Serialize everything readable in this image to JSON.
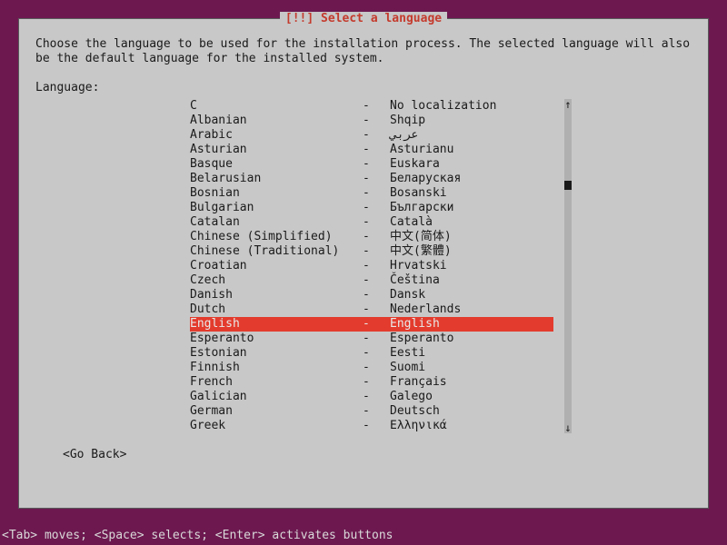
{
  "dialog": {
    "title": "[!!] Select a language",
    "instruction": "Choose the language to be used for the installation process. The selected language will also be the default language for the installed system.",
    "label": "Language:",
    "go_back": "<Go Back>"
  },
  "selected_index": 15,
  "languages": [
    {
      "name": "C",
      "native": "No localization"
    },
    {
      "name": "Albanian",
      "native": "Shqip"
    },
    {
      "name": "Arabic",
      "native": "عربي"
    },
    {
      "name": "Asturian",
      "native": "Asturianu"
    },
    {
      "name": "Basque",
      "native": "Euskara"
    },
    {
      "name": "Belarusian",
      "native": "Беларуская"
    },
    {
      "name": "Bosnian",
      "native": "Bosanski"
    },
    {
      "name": "Bulgarian",
      "native": "Български"
    },
    {
      "name": "Catalan",
      "native": "Català"
    },
    {
      "name": "Chinese (Simplified)",
      "native": "中文(简体)"
    },
    {
      "name": "Chinese (Traditional)",
      "native": "中文(繁體)"
    },
    {
      "name": "Croatian",
      "native": "Hrvatski"
    },
    {
      "name": "Czech",
      "native": "Čeština"
    },
    {
      "name": "Danish",
      "native": "Dansk"
    },
    {
      "name": "Dutch",
      "native": "Nederlands"
    },
    {
      "name": "English",
      "native": "English"
    },
    {
      "name": "Esperanto",
      "native": "Esperanto"
    },
    {
      "name": "Estonian",
      "native": "Eesti"
    },
    {
      "name": "Finnish",
      "native": "Suomi"
    },
    {
      "name": "French",
      "native": "Français"
    },
    {
      "name": "Galician",
      "native": "Galego"
    },
    {
      "name": "German",
      "native": "Deutsch"
    },
    {
      "name": "Greek",
      "native": "Ελληνικά"
    }
  ],
  "separator": "-",
  "footer": "<Tab> moves; <Space> selects; <Enter> activates buttons"
}
